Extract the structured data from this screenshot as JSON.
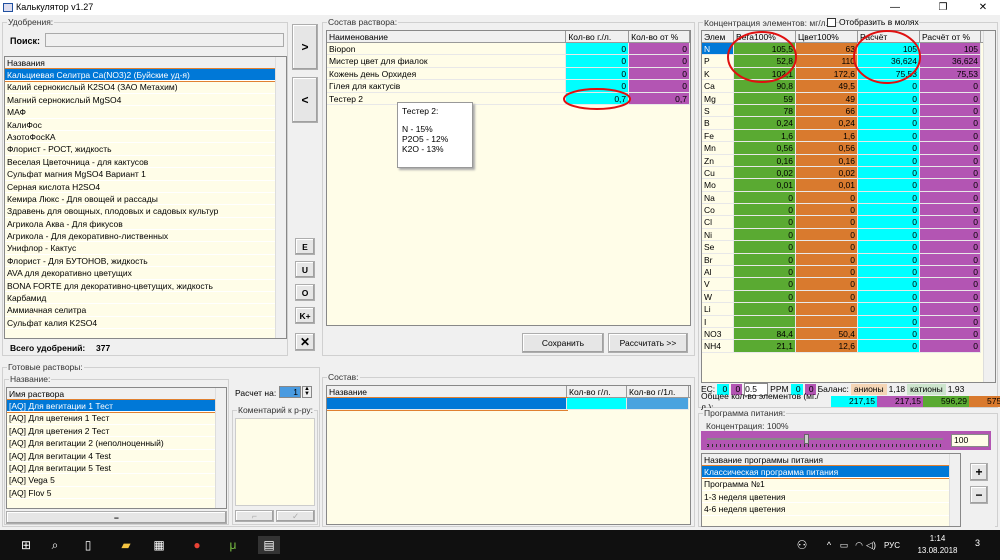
{
  "window": {
    "title": "Калькулятор v1.27",
    "minimize": "—",
    "maximize": "❐",
    "close": "✕"
  },
  "fert": {
    "group": "Удобрения:",
    "search_label": "Поиск:",
    "search_value": "",
    "col": "Названия",
    "total_label": "Всего удобрений:",
    "total": "377",
    "items": [
      "Кальциевая Селитра Ca(NO3)2 (Буйские уд-я)",
      "Калий  сернокислый  K2SO4 (ЗАО Метахим)",
      "Магний сернокислый MgSO4",
      "МАФ",
      "КалиФос",
      "АзотоФосКА",
      "Флорист - РОСТ, жидкость",
      "Веселая Цветочница - для кактусов",
      "Сульфат магния MgSO4 Вариант 1",
      "Серная кислота H2SO4",
      "Кемира Люкс - Для овощей и рассады",
      "Здравень для овощных, плодовых и садовых культур",
      "Агрикола Аква - Для фикусов",
      "Агрикола - Для декоративно-лиственных",
      "Унифлор - Кактус",
      "Флорист - Для БУТОНОВ, жидкость",
      "AVA для декоративно цветущих",
      "BONA FORTE для декоративно-цветущих, жидкость",
      "Карбамид",
      "Аммиачная селитра",
      "Сульфат калия K2SO4"
    ]
  },
  "side_buttons": {
    "add": ">",
    "remove": "<",
    "e": "E",
    "u": "U",
    "o": "O",
    "kplus": "K+",
    "clear": "✕"
  },
  "solution": {
    "group": "Состав раствора:",
    "cols": [
      "Наименование",
      "Кол-во г./л.",
      "Кол-во от %"
    ],
    "rows": [
      {
        "name": "Biopon",
        "qty": "0",
        "pct": "0"
      },
      {
        "name": "Мистер цвет для фиалок",
        "qty": "0",
        "pct": "0"
      },
      {
        "name": "Кожень день Орхидея",
        "qty": "0",
        "pct": "0"
      },
      {
        "name": "Гілея для кактусів",
        "qty": "0",
        "pct": "0"
      },
      {
        "name": "Тестер 2",
        "qty": "0,7",
        "pct": "0,7"
      }
    ],
    "tooltip": {
      "title": "Тестер 2:",
      "lines": [
        "N - 15%",
        "P2O5 - 12%",
        "K2O - 13%"
      ]
    },
    "save": "Сохранить",
    "calc": "Рассчитать >>"
  },
  "elements": {
    "group": "Концентрация элементов: мг/л.",
    "moles_label": "Отобразить в молях",
    "moles_checked": false,
    "cols": [
      "Элем",
      "Вега100%",
      "Цвет100%",
      "Расчёт",
      "Расчёт от %"
    ],
    "rows": [
      [
        "N",
        "105,5",
        "63",
        "105",
        "105"
      ],
      [
        "P",
        "52,8",
        "110",
        "36,624",
        "36,624"
      ],
      [
        "K",
        "102,1",
        "172,6",
        "75,53",
        "75,53"
      ],
      [
        "Ca",
        "90,8",
        "49,5",
        "0",
        "0"
      ],
      [
        "Mg",
        "59",
        "49",
        "0",
        "0"
      ],
      [
        "S",
        "78",
        "66",
        "0",
        "0"
      ],
      [
        "B",
        "0,24",
        "0,24",
        "0",
        "0"
      ],
      [
        "Fe",
        "1,6",
        "1,6",
        "0",
        "0"
      ],
      [
        "Mn",
        "0,56",
        "0,56",
        "0",
        "0"
      ],
      [
        "Zn",
        "0,16",
        "0,16",
        "0",
        "0"
      ],
      [
        "Cu",
        "0,02",
        "0,02",
        "0",
        "0"
      ],
      [
        "Mo",
        "0,01",
        "0,01",
        "0",
        "0"
      ],
      [
        "Na",
        "0",
        "0",
        "0",
        "0"
      ],
      [
        "Co",
        "0",
        "0",
        "0",
        "0"
      ],
      [
        "Cl",
        "0",
        "0",
        "0",
        "0"
      ],
      [
        "Ni",
        "0",
        "0",
        "0",
        "0"
      ],
      [
        "Se",
        "0",
        "0",
        "0",
        "0"
      ],
      [
        "Br",
        "0",
        "0",
        "0",
        "0"
      ],
      [
        "Al",
        "0",
        "0",
        "0",
        "0"
      ],
      [
        "V",
        "0",
        "0",
        "0",
        "0"
      ],
      [
        "W",
        "0",
        "0",
        "0",
        "0"
      ],
      [
        "Li",
        "0",
        "0",
        "0",
        "0"
      ],
      [
        "I",
        "",
        "",
        "0",
        "0"
      ],
      [
        "NO3",
        "84,4",
        "50,4",
        "0",
        "0"
      ],
      [
        "NH4",
        "21,1",
        "12,6",
        "0",
        "0"
      ]
    ],
    "colors": [
      "#5aaa32",
      "#d97a2e",
      "#00ffff",
      "#b355b3"
    ],
    "ec_label": "EC:",
    "ec1": "0",
    "ec2": "0",
    "ec_step": "0.5",
    "ppm_label": "PPM",
    "ppm1": "0",
    "ppm2": "0",
    "balance_label": "Баланс:",
    "anions_label": "анионы",
    "anions": "1,18",
    "cations_label": "катионы",
    "cations": "1,93",
    "total_label": "Общее кол-во элементов (мг./л.):",
    "totals": [
      "217,15",
      "217,15",
      "596,29",
      "575,69"
    ]
  },
  "ready": {
    "group": "Готовые растворы:",
    "name_group": "Название:",
    "col": "Имя раствора",
    "items": [
      "[AQ] Для вегитации 1 Тест",
      "[AQ] Для цветения 1 Тест",
      "[AQ] Для цветения 2 Тест",
      "[AQ] Для вегитации 2 (неполноценный)",
      "[AQ] Для вегитации 4 Test",
      "[AQ] Для вегитации 5 Test",
      "[AQ] Vega 5",
      "[AQ] Flov 5"
    ],
    "minus": "−",
    "calc_for_label": "Расчет на:",
    "calc_for": "1",
    "comment_label": "Коментарий к р-ру:"
  },
  "composition": {
    "group": "Состав:",
    "cols": [
      "Название",
      "Кол-во г/л.",
      "Кол-во г/1л."
    ]
  },
  "program": {
    "group": "Программа питания:",
    "conc_label": "Концентрация: 100%",
    "slider_value": 100,
    "value": "100",
    "col": "Название программы питания",
    "items": [
      "Классическая программа питания",
      "Программа №1",
      "1-3 неделя цветения",
      "4-6 неделя цветения"
    ],
    "plus": "+",
    "minus": "−"
  },
  "taskbar": {
    "lang": "РУС",
    "time": "1:14",
    "date": "13.08.2018",
    "notifications": "3"
  }
}
